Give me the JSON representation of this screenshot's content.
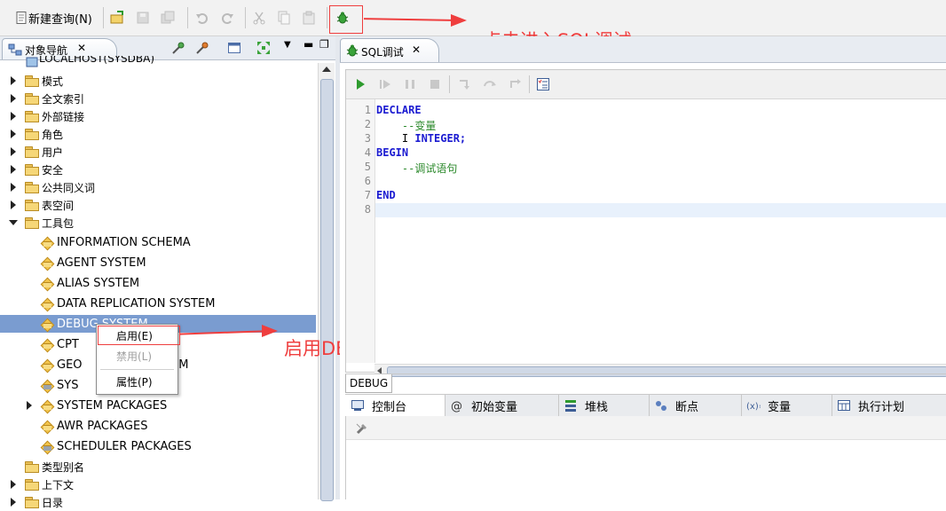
{
  "toolbar": {
    "new_query_label": "新建查询(N)"
  },
  "nav": {
    "tab_label": "对象导航",
    "root_label": "LOCALHOST(SYSDBA)",
    "items": [
      {
        "label": "模式",
        "state": "closed",
        "icon": "folder",
        "indent": 0
      },
      {
        "label": "全文索引",
        "state": "closed",
        "icon": "folder",
        "indent": 0
      },
      {
        "label": "外部链接",
        "state": "closed",
        "icon": "folder",
        "indent": 0
      },
      {
        "label": "角色",
        "state": "closed",
        "icon": "folder",
        "indent": 0
      },
      {
        "label": "用户",
        "state": "closed",
        "icon": "folder",
        "indent": 0
      },
      {
        "label": "安全",
        "state": "closed",
        "icon": "folder",
        "indent": 0
      },
      {
        "label": "公共同义词",
        "state": "closed",
        "icon": "folder",
        "indent": 0
      },
      {
        "label": "表空间",
        "state": "closed",
        "icon": "folder",
        "indent": 0
      },
      {
        "label": "工具包",
        "state": "open",
        "icon": "folder",
        "indent": 0
      },
      {
        "label": "INFORMATION SCHEMA",
        "state": "none",
        "icon": "package",
        "indent": 1
      },
      {
        "label": "AGENT SYSTEM",
        "state": "none",
        "icon": "package",
        "indent": 1
      },
      {
        "label": "ALIAS SYSTEM",
        "state": "none",
        "icon": "package",
        "indent": 1
      },
      {
        "label": "DATA REPLICATION SYSTEM",
        "state": "none",
        "icon": "package",
        "indent": 1
      },
      {
        "label": "DEBUG SYSTEM",
        "state": "none",
        "icon": "package",
        "indent": 1,
        "selected": true
      },
      {
        "label": "CPT",
        "state": "none",
        "icon": "package",
        "indent": 1
      },
      {
        "label": "GEO",
        "suffix": "EM",
        "state": "none",
        "icon": "package",
        "indent": 1
      },
      {
        "label": "SYS",
        "state": "none",
        "icon": "package-gear",
        "indent": 1
      },
      {
        "label": "SYSTEM PACKAGES",
        "state": "closed",
        "icon": "package",
        "indent": 1
      },
      {
        "label": "AWR PACKAGES",
        "state": "none",
        "icon": "package",
        "indent": 1
      },
      {
        "label": "SCHEDULER PACKAGES",
        "state": "none",
        "icon": "package-gear",
        "indent": 1
      },
      {
        "label": "类型别名",
        "state": "none",
        "icon": "folder",
        "indent": 0
      },
      {
        "label": "上下文",
        "state": "closed",
        "icon": "folder",
        "indent": 0
      },
      {
        "label": "日录",
        "state": "closed",
        "icon": "folder",
        "indent": 0
      }
    ]
  },
  "context_menu": {
    "enable": "启用(E)",
    "disable": "禁用(L)",
    "properties": "属性(P)"
  },
  "editor": {
    "tab_label": "SQL调试",
    "lines": [
      {
        "n": "1",
        "parts": [
          {
            "t": "DECLARE",
            "c": "kw"
          }
        ]
      },
      {
        "n": "2",
        "parts": [
          {
            "t": "    --变量",
            "c": "cm"
          }
        ]
      },
      {
        "n": "3",
        "parts": [
          {
            "t": "    I ",
            "c": ""
          },
          {
            "t": "INTEGER;",
            "c": "kw"
          }
        ]
      },
      {
        "n": "4",
        "parts": [
          {
            "t": "BEGIN",
            "c": "kw"
          }
        ]
      },
      {
        "n": "5",
        "parts": [
          {
            "t": "    --调试语句",
            "c": "cm"
          }
        ]
      },
      {
        "n": "6",
        "parts": []
      },
      {
        "n": "7",
        "parts": [
          {
            "t": "END",
            "c": "kw"
          }
        ]
      },
      {
        "n": "8",
        "parts": []
      }
    ]
  },
  "debug_label": "DEBUG",
  "bottom_tabs": [
    "控制台",
    "初始变量",
    "堆栈",
    "断点",
    "变量",
    "执行计划"
  ],
  "annotations": {
    "enter_debug": "点击进入SQL调试",
    "enable_debug": "启用DEBUG SYSTEM包"
  },
  "colors": {
    "accent_red": "#ef3e3e",
    "selection": "#7a9cd0",
    "keyword": "#1b1bd1",
    "comment": "#2d8a2d"
  }
}
